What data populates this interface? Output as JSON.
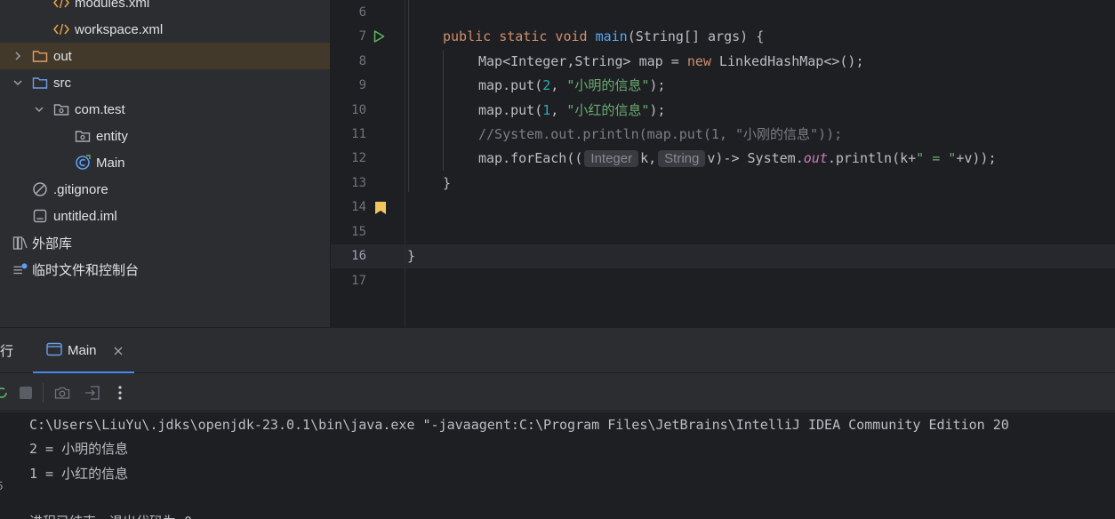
{
  "project_tree": {
    "items": [
      {
        "label": "modules.xml",
        "type": "xml-file"
      },
      {
        "label": "workspace.xml",
        "type": "xml-file"
      },
      {
        "label": "out",
        "type": "folder",
        "expanded": false,
        "selected": true
      },
      {
        "label": "src",
        "type": "folder",
        "expanded": true
      },
      {
        "label": "com.test",
        "type": "package",
        "expanded": true
      },
      {
        "label": "entity",
        "type": "package"
      },
      {
        "label": "Main",
        "type": "java-class"
      },
      {
        "label": ".gitignore",
        "type": "ignore-file"
      },
      {
        "label": "untitled.iml",
        "type": "iml-file"
      },
      {
        "label": "外部库",
        "type": "libraries"
      },
      {
        "label": "临时文件和控制台",
        "type": "scratches"
      }
    ]
  },
  "editor": {
    "line_numbers": [
      "6",
      "7",
      "8",
      "9",
      "10",
      "11",
      "12",
      "13",
      "14",
      "15",
      "16",
      "17"
    ],
    "current_line": "16",
    "code": {
      "l7": {
        "kw1": "public static void ",
        "fn": "main",
        "rest": "(String[] args) {"
      },
      "l8": {
        "a": "Map<Integer,String> map = ",
        "kw": "new",
        "b": " LinkedHashMap<>();"
      },
      "l9": {
        "a": "map.put(",
        "num": "2",
        "b": ", ",
        "str": "\"小明的信息\"",
        "c": ");"
      },
      "l10": {
        "a": "map.put(",
        "num": "1",
        "b": ", ",
        "str": "\"小红的信息\"",
        "c": ");"
      },
      "l11": {
        "comment": "//System.out.println(map.put(1, \"小刚的信息\"));"
      },
      "l12": {
        "a": "map.forEach((",
        "hint1": "Integer",
        "b": "k,",
        "hint2": "String",
        "c": "v)-> System.",
        "out": "out",
        "d": ".println(k+",
        "str": "\" = \"",
        "e": "+v));"
      },
      "l13": "}",
      "l16": "}"
    }
  },
  "run_panel": {
    "title_fragment": "行",
    "tab_label": "Main",
    "console_lines": [
      "C:\\Users\\LiuYu\\.jdks\\openjdk-23.0.1\\bin\\java.exe \"-javaagent:C:\\Program Files\\JetBrains\\IntelliJ IDEA Community Edition 20",
      "2 = 小明的信息",
      "1 = 小红的信息",
      "",
      "进程已结束，退出代码为 0"
    ]
  },
  "colors": {
    "background": "#1e1f22",
    "panel": "#2b2d30",
    "keyword": "#cf8e6d",
    "function": "#56a8f5",
    "string": "#6aab73",
    "number": "#2aacb8",
    "comment": "#7a7e85",
    "static_field": "#c77dbb",
    "selection": "#43392b"
  }
}
